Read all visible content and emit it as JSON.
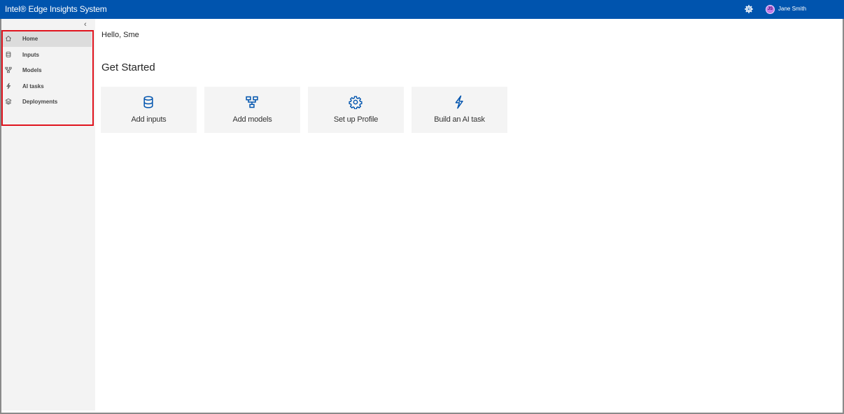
{
  "header": {
    "title": "Intel® Edge Insights System",
    "settings_icon": "gear-icon",
    "user": {
      "initials": "JS",
      "name": "Jane Smith",
      "avatar_color": "#c27ce6"
    },
    "brand_color": "#0054ae"
  },
  "sidebar": {
    "collapse_icon": "chevron-left-icon",
    "items": [
      {
        "label": "Home",
        "icon": "home-icon",
        "active": true
      },
      {
        "label": "Inputs",
        "icon": "database-icon",
        "active": false
      },
      {
        "label": "Models",
        "icon": "models-icon",
        "active": false
      },
      {
        "label": "AI tasks",
        "icon": "lightning-icon",
        "active": false
      },
      {
        "label": "Deployments",
        "icon": "deployments-icon",
        "active": false
      }
    ],
    "highlight_color": "#e0141e"
  },
  "main": {
    "greeting": "Hello, Sme",
    "section_title": "Get Started",
    "cards": [
      {
        "label": "Add inputs",
        "icon": "database-icon"
      },
      {
        "label": "Add models",
        "icon": "models-icon"
      },
      {
        "label": "Set up Profile",
        "icon": "gear-icon"
      },
      {
        "label": "Build an AI task",
        "icon": "lightning-icon"
      }
    ],
    "accent_color": "#0054ae"
  }
}
